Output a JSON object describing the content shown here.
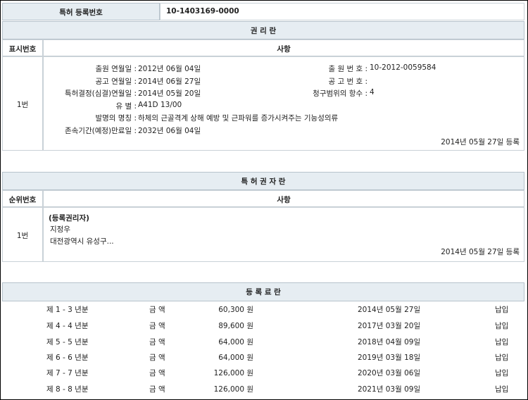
{
  "reg_number": {
    "label": "특허 등록번호",
    "value": "10-1403169-0000"
  },
  "rights": {
    "section_title": "권 리 란",
    "col_index": "표시번호",
    "col_matter": "사항",
    "index_value": "1번",
    "fields": [
      {
        "label": "출원 연월일 :",
        "value": "2012년 06월 04일"
      },
      {
        "label": "공고 연월일 :",
        "value": "2014년 06월 27일"
      },
      {
        "label": "특허결정(심결)연월일 :",
        "value": "2014년 05월 20일"
      },
      {
        "label": "유 별 :",
        "value": "A41D 13/00"
      },
      {
        "label": "발명의 명칭 :",
        "value": "하체의 근골격계 상해 예방 및 근파워를 증가시켜주는 기능성의류"
      },
      {
        "label": "존속기간(예정)만료일 :",
        "value": "2032년 06월 04일"
      }
    ],
    "right_fields": [
      {
        "label": "출 원 번 호 :",
        "value": "10-2012-0059584"
      },
      {
        "label": "공 고 번 호 :",
        "value": ""
      },
      {
        "label": "청구범위의 항수 :",
        "value": "4"
      }
    ],
    "registered": "2014년 05월 27일 등록"
  },
  "holder": {
    "section_title": "특 허 권 자 란",
    "col_index": "순위번호",
    "col_matter": "사항",
    "index_value": "1번",
    "type": "(등록권리자)",
    "name": "지정우",
    "address": "대전광역시 유성구...",
    "registered": "2014년 05월 27일 등록"
  },
  "fees": {
    "section_title": "등 록 료 란",
    "rows": [
      {
        "period": "제 1 - 3 년분",
        "label": "금 액",
        "amount": "60,300 원",
        "date": "2014년 05월 27일",
        "status": "납입"
      },
      {
        "period": "제 4 - 4 년분",
        "label": "금 액",
        "amount": "89,600 원",
        "date": "2017년 03월 20일",
        "status": "납입"
      },
      {
        "period": "제 5 - 5 년분",
        "label": "금 액",
        "amount": "64,000 원",
        "date": "2018년 04월 09일",
        "status": "납입"
      },
      {
        "period": "제 6 - 6 년분",
        "label": "금 액",
        "amount": "64,000 원",
        "date": "2019년 03월 18일",
        "status": "납입"
      },
      {
        "period": "제 7 - 7 년분",
        "label": "금 액",
        "amount": "126,000 원",
        "date": "2020년 03월 06일",
        "status": "납입"
      },
      {
        "period": "제 8 - 8 년분",
        "label": "금 액",
        "amount": "126,000 원",
        "date": "2021년 03월 09일",
        "status": "납입"
      }
    ]
  }
}
